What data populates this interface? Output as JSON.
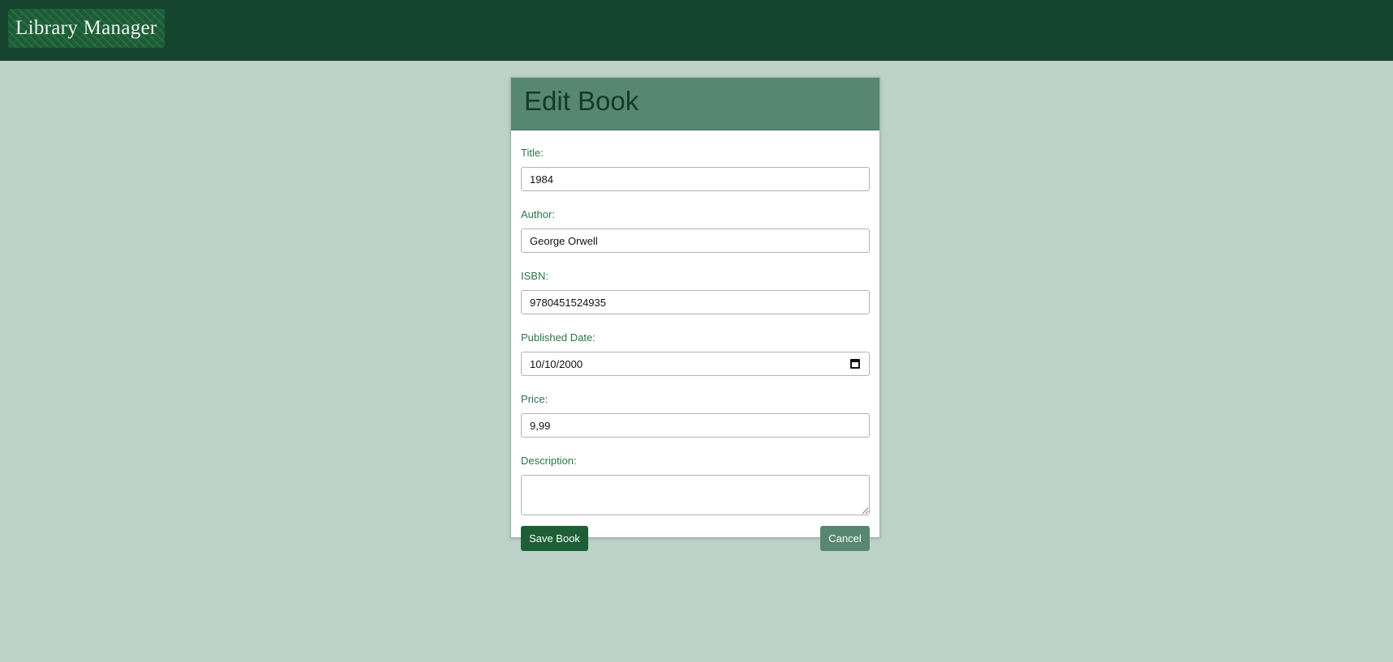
{
  "app": {
    "title": "Library Manager"
  },
  "page": {
    "title": "Edit Book"
  },
  "form": {
    "title": {
      "label": "Title:",
      "value": "1984"
    },
    "author": {
      "label": "Author:",
      "value": "George Orwell"
    },
    "isbn": {
      "label": "ISBN:",
      "value": "9780451524935"
    },
    "published_date": {
      "label": "Published Date:",
      "value": "10/10/2000",
      "icon": "calendar-icon"
    },
    "price": {
      "label": "Price:",
      "value": "9,99"
    },
    "description": {
      "label": "Description:",
      "value": ""
    }
  },
  "actions": {
    "save_label": "Save Book",
    "cancel_label": "Cancel"
  },
  "colors": {
    "header_bg": "#15452f",
    "page_bg": "#bcd1c8",
    "card_header_bg": "#578770",
    "primary_button": "#1d5e36",
    "secondary_button": "#578770",
    "label_text": "#2b7548"
  }
}
